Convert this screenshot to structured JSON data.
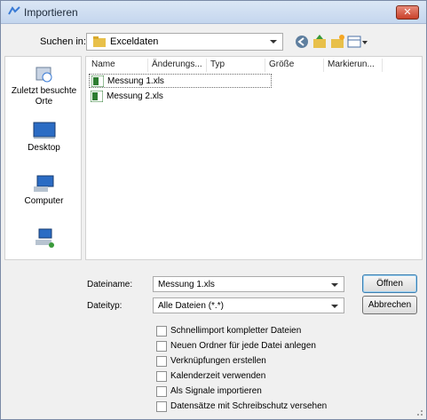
{
  "window": {
    "title": "Importieren",
    "close_label": "✕"
  },
  "lookin": {
    "label": "Suchen in:",
    "value": "Exceldaten"
  },
  "places": [
    {
      "label": "Zuletzt besuchte Orte",
      "icon": "recent-places-icon"
    },
    {
      "label": "Desktop",
      "icon": "desktop-icon"
    },
    {
      "label": "Computer",
      "icon": "computer-icon"
    },
    {
      "label": "",
      "icon": "network-icon"
    }
  ],
  "columns": [
    "Name",
    "Änderungs...",
    "Typ",
    "Größe",
    "Markierun..."
  ],
  "files": [
    {
      "name": "Messung 1.xls",
      "selected": true
    },
    {
      "name": "Messung 2.xls",
      "selected": false
    }
  ],
  "filename": {
    "label": "Dateiname:",
    "value": "Messung 1.xls"
  },
  "filetype": {
    "label": "Dateityp:",
    "value": "Alle Dateien (*.*)"
  },
  "buttons": {
    "open": "Öffnen",
    "cancel": "Abbrechen"
  },
  "options": [
    "Schnellimport kompletter Dateien",
    "Neuen Ordner für jede Datei anlegen",
    "Verknüpfungen erstellen",
    "Kalenderzeit verwenden",
    "Als Signale importieren",
    "Datensätze mit Schreibschutz versehen"
  ],
  "colors": {
    "accent": "#3c7fb1",
    "titlebar": "#c4d6ee",
    "close": "#c9412b"
  }
}
